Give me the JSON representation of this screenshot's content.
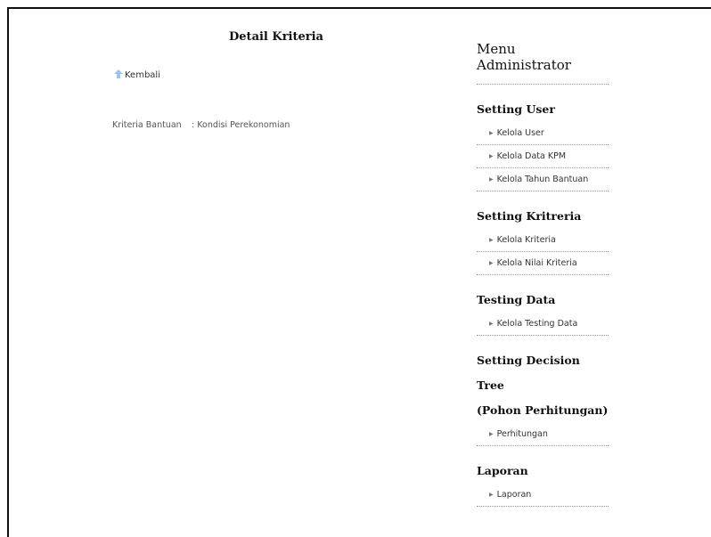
{
  "main": {
    "title": "Detail Kriteria",
    "back_label": "Kembali",
    "detail": {
      "label": "Kriteria Bantuan",
      "value": ": Kondisi Perekonomian"
    }
  },
  "sidebar": {
    "title": "Menu Administrator",
    "groups": [
      {
        "title": "Setting User",
        "items": [
          "Kelola User",
          "Kelola Data KPM",
          "Kelola Tahun Bantuan"
        ]
      },
      {
        "title": "Setting Kritreria",
        "items": [
          "Kelola Kriteria",
          "Kelola Nilai Kriteria"
        ]
      },
      {
        "title": "Testing Data",
        "items": [
          "Kelola Testing Data"
        ]
      },
      {
        "title": "Setting Decision Tree",
        "title2": "(Pohon Perhitungan)",
        "items": [
          "Perhitungan"
        ]
      },
      {
        "title": "Laporan",
        "items": [
          "Laporan"
        ]
      }
    ]
  },
  "icons": {
    "back": "up-arrow-icon",
    "menu_bullet": "triangle-right-icon"
  },
  "colors": {
    "back_arrow": "#9ec4ea",
    "text": "#333333",
    "border": "#111111"
  }
}
